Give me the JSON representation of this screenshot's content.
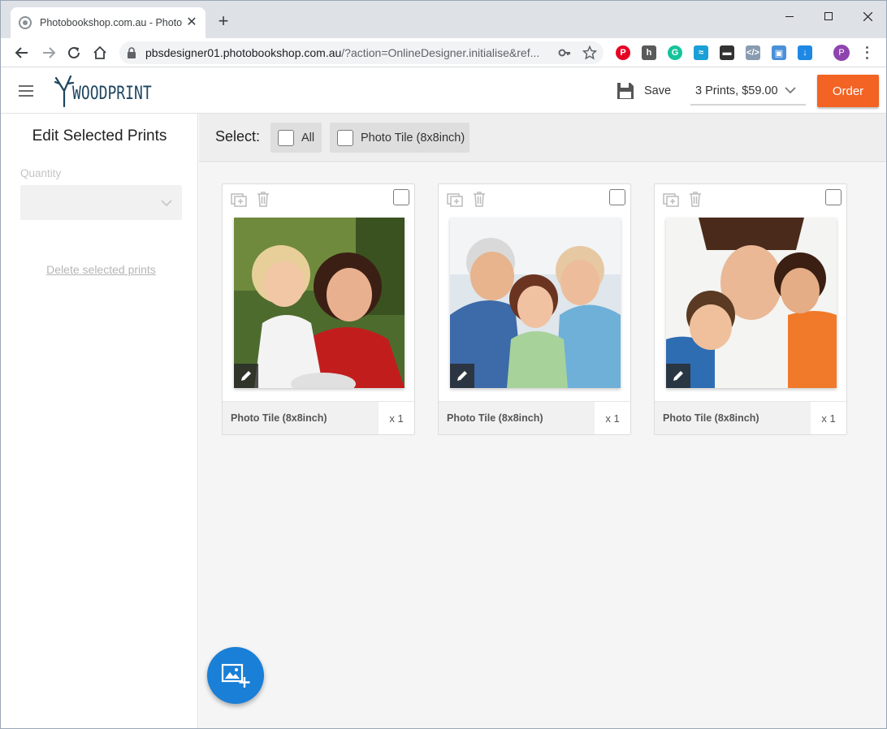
{
  "browser": {
    "tab_title": "Photobookshop.com.au - Photo T",
    "url_host": "pbsdesigner01.photobookshop.com.au",
    "url_rest": "/?action=OnlineDesigner.initialise&ref...",
    "profile_initial": "P"
  },
  "app": {
    "logo_text": "WOODPRINT",
    "save_label": "Save",
    "cart_summary": "3 Prints, $59.00",
    "order_label": "Order"
  },
  "panel": {
    "title": "Edit Selected Prints",
    "quantity_label": "Quantity",
    "quantity_value": "",
    "delete_link": "Delete selected prints"
  },
  "select_bar": {
    "label": "Select:",
    "all_label": "All",
    "type_label": "Photo Tile (8x8inch)"
  },
  "prints": [
    {
      "name": "Photo Tile (8x8inch)",
      "qty": "x 1",
      "photo": "mother-and-daughter"
    },
    {
      "name": "Photo Tile (8x8inch)",
      "qty": "x 1",
      "photo": "grandparents-and-girl"
    },
    {
      "name": "Photo Tile (8x8inch)",
      "qty": "x 1",
      "photo": "three-faces-looking-down"
    }
  ],
  "colors": {
    "accent_order": "#f26324",
    "fab_blue": "#1a7fd6",
    "logo_navy": "#1e4660"
  }
}
